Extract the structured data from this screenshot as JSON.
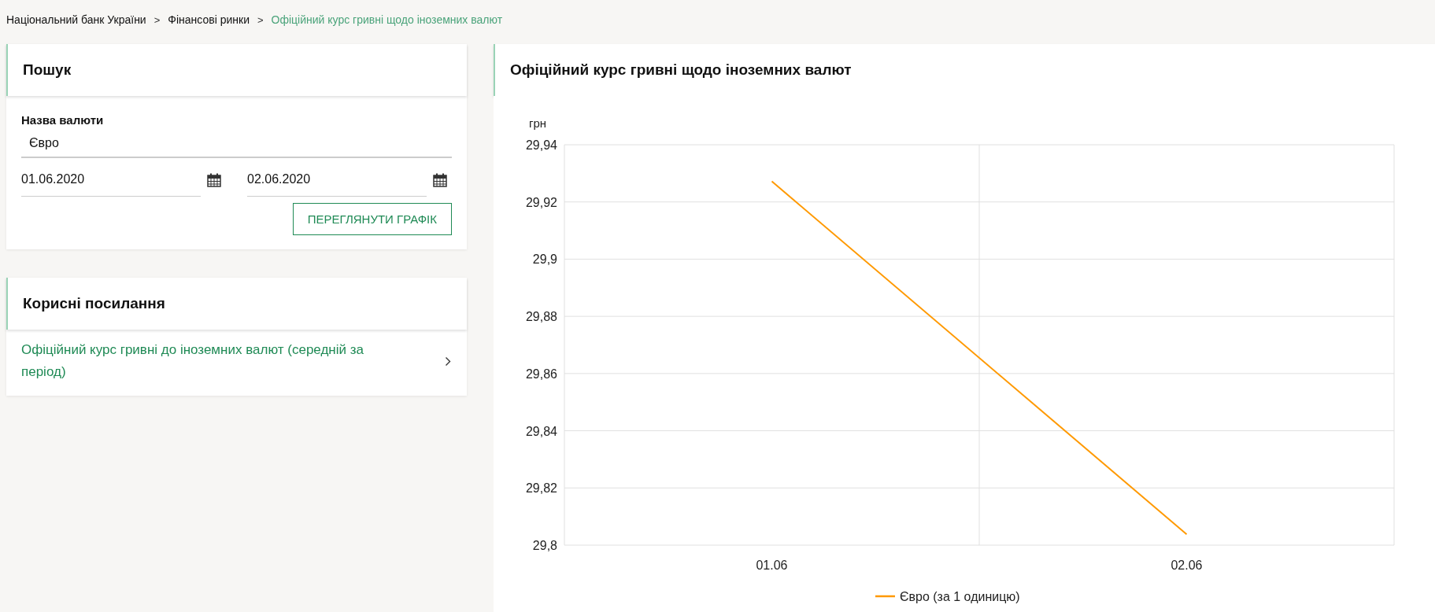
{
  "breadcrumbs": [
    {
      "label": "Національний банк України",
      "current": false
    },
    {
      "label": "Фінансові ринки",
      "current": false
    },
    {
      "label": "Офіційний курс гривні щодо іноземних валют",
      "current": true
    }
  ],
  "breadcrumb_separator": ">",
  "search_panel": {
    "title": "Пошук",
    "currency_label": "Назва валюти",
    "currency_value": "Євро",
    "date_from": "01.06.2020",
    "date_to": "02.06.2020",
    "button": "ПЕРЕГЛЯНУТИ ГРАФІК"
  },
  "links_panel": {
    "title": "Корисні посилання",
    "links": [
      {
        "label": "Офіційний курс гривні до іноземних валют (середній за період)"
      }
    ]
  },
  "chart_panel": {
    "title": "Офіційний курс гривні щодо іноземних валют",
    "chart_data": {
      "type": "line",
      "ylabel": "грн",
      "categories": [
        "01.06",
        "02.06"
      ],
      "series": [
        {
          "name": "Євро (за 1 одиницю)",
          "color": "#ff9900",
          "values": [
            29.9272,
            29.8038
          ]
        }
      ],
      "ylim": [
        29.8,
        29.94
      ],
      "grid": true,
      "yticks": [
        {
          "value": 29.8,
          "label": "29,8"
        },
        {
          "value": 29.82,
          "label": "29,82"
        },
        {
          "value": 29.84,
          "label": "29,84"
        },
        {
          "value": 29.86,
          "label": "29,86"
        },
        {
          "value": 29.88,
          "label": "29,88"
        },
        {
          "value": 29.9,
          "label": "29,9"
        },
        {
          "value": 29.92,
          "label": "29,92"
        },
        {
          "value": 29.94,
          "label": "29,94"
        }
      ]
    }
  }
}
